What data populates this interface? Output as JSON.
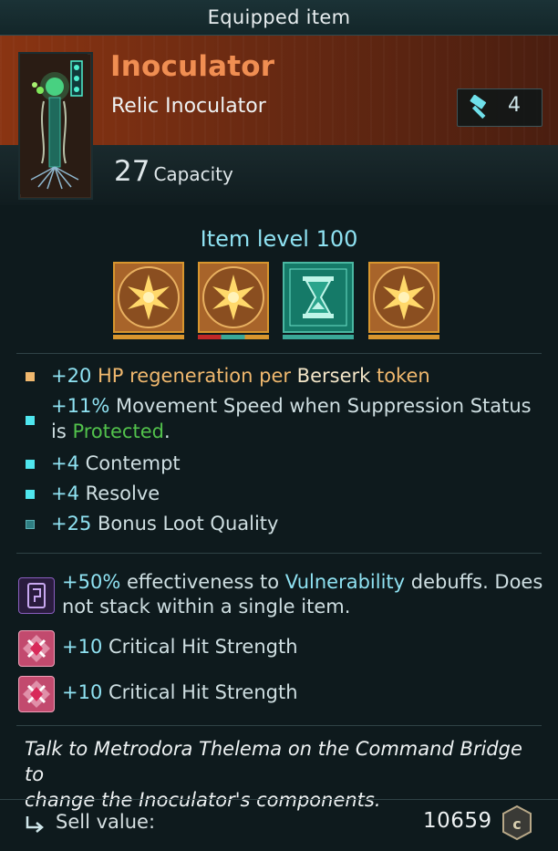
{
  "header": {
    "title": "Equipped item"
  },
  "item": {
    "name": "Inoculator",
    "type": "Relic Inoculator",
    "tier": "4",
    "capacity_value": "27",
    "capacity_label": "Capacity",
    "item_level": "Item level 100"
  },
  "mods": [
    {
      "icon": "radiant-star-icon"
    },
    {
      "icon": "radiant-star-icon"
    },
    {
      "icon": "hourglass-icon"
    },
    {
      "icon": "radiant-star-icon"
    }
  ],
  "stats": [
    {
      "bullet": "gold",
      "value": "+20",
      "text_a": " HP regeneration per ",
      "text_b": "Berserk",
      "text_c": " token"
    },
    {
      "bullet": "teal",
      "value": "+11%",
      "text_a": " Movement Speed when Suppression Status",
      "line2_a": "is ",
      "line2_b": "Protected",
      "line2_c": "."
    },
    {
      "bullet": "teal",
      "value": "+4",
      "text": " Contempt"
    },
    {
      "bullet": "teal",
      "value": "+4",
      "text": " Resolve"
    },
    {
      "bullet": "dim-teal",
      "value": "+25",
      "text": " Bonus Loot Quality"
    }
  ],
  "perks": [
    {
      "icon": "vulnerability-gem-icon",
      "value": "+50%",
      "text_a": " effectiveness to ",
      "highlight": "Vulnerability",
      "text_b": " debuffs. Does",
      "line2": "not stack within a single item."
    },
    {
      "icon": "crit-gem-icon",
      "value": "+10",
      "text": " Critical Hit Strength"
    },
    {
      "icon": "crit-gem-icon",
      "value": "+10",
      "text": " Critical Hit Strength"
    }
  ],
  "flavor": {
    "line1": "Talk to Metrodora Thelema on the Command Bridge to",
    "line2": "change the Inoculator's components."
  },
  "footer": {
    "sell_label": "Sell value:",
    "sell_value": "10659",
    "currency_icon": "glimmer-coin-icon"
  },
  "colors": {
    "title": "#f08e52",
    "accent_teal": "#8fe2f2",
    "gold": "#f0b86e",
    "green": "#52c24c",
    "hero_bg": "#8a3412",
    "panel_bg": "#0e1a1d"
  }
}
